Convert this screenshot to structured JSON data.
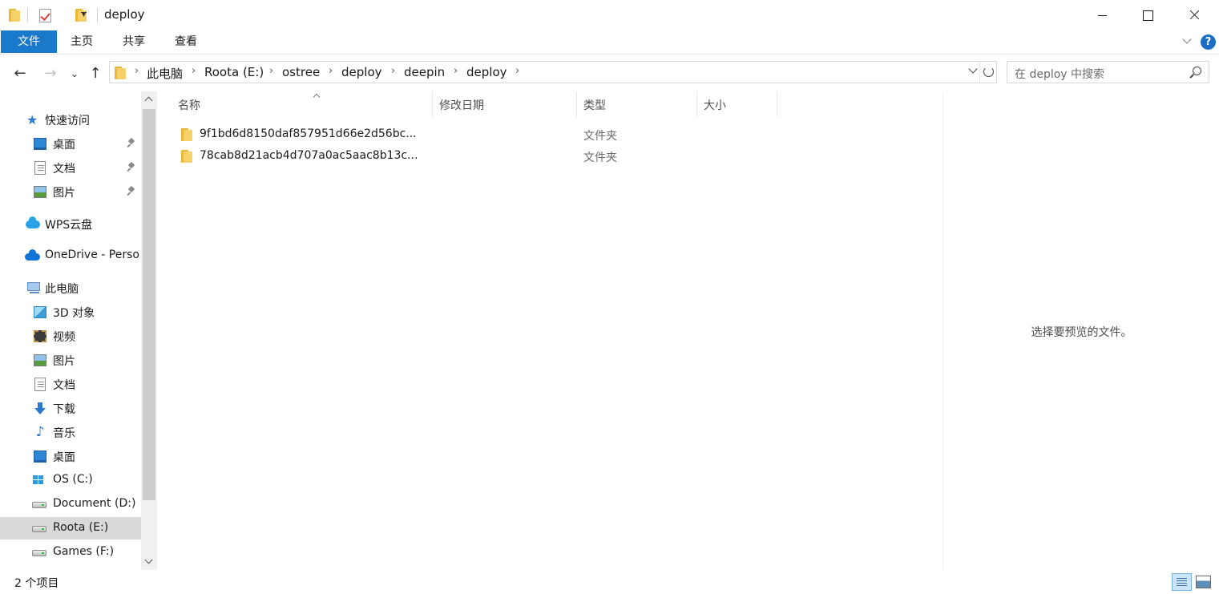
{
  "window": {
    "title": "deploy"
  },
  "quick_access_toolbar": {
    "icons": [
      "folder-icon",
      "properties-icon",
      "new-folder-icon",
      "customize-dropdown-icon"
    ]
  },
  "ribbon": {
    "tabs": [
      {
        "label": "文件",
        "active": true
      },
      {
        "label": "主页"
      },
      {
        "label": "共享"
      },
      {
        "label": "查看"
      }
    ],
    "help_label": "?"
  },
  "navigation": {
    "back": "←",
    "forward": "→",
    "recent": "⌄",
    "up": "↑"
  },
  "address": {
    "breadcrumbs": [
      "此电脑",
      "Roota (E:)",
      "ostree",
      "deploy",
      "deepin",
      "deploy"
    ],
    "separator": "›"
  },
  "search": {
    "placeholder": "在 deploy 中搜索"
  },
  "sidebar": {
    "quick_access": {
      "label": "快速访问",
      "items": [
        {
          "label": "桌面",
          "icon": "desktop-icon",
          "pinned": true
        },
        {
          "label": "文档",
          "icon": "document-icon",
          "pinned": true
        },
        {
          "label": "图片",
          "icon": "pictures-icon",
          "pinned": true
        }
      ]
    },
    "wps": {
      "label": "WPS云盘",
      "icon": "cloud-icon"
    },
    "onedrive": {
      "label": "OneDrive - Perso",
      "icon": "onedrive-icon"
    },
    "this_pc": {
      "label": "此电脑",
      "items": [
        {
          "label": "3D 对象",
          "icon": "3d-objects-icon"
        },
        {
          "label": "视频",
          "icon": "video-icon"
        },
        {
          "label": "图片",
          "icon": "pictures-icon"
        },
        {
          "label": "文档",
          "icon": "document-icon"
        },
        {
          "label": "下载",
          "icon": "download-icon"
        },
        {
          "label": "音乐",
          "icon": "music-icon"
        },
        {
          "label": "桌面",
          "icon": "desktop-icon"
        },
        {
          "label": "OS (C:)",
          "icon": "os-drive-icon"
        },
        {
          "label": "Document (D:)",
          "icon": "drive-icon"
        },
        {
          "label": "Roota (E:)",
          "icon": "drive-icon",
          "selected": true
        },
        {
          "label": "Games (F:)",
          "icon": "drive-icon"
        }
      ]
    }
  },
  "file_list": {
    "columns": [
      "名称",
      "修改日期",
      "类型",
      "大小"
    ],
    "rows": [
      {
        "name": "9f1bd6d8150daf857951d66e2d56bc...",
        "type": "文件夹",
        "icon": "folder-icon"
      },
      {
        "name": "78cab8d21acb4d707a0ac5aac8b13c...",
        "type": "文件夹",
        "icon": "folder-icon"
      }
    ]
  },
  "preview_pane": {
    "message": "选择要预览的文件。"
  },
  "status_bar": {
    "item_count": "2 个项目",
    "view_icons": [
      "details-view-icon",
      "large-icons-view-icon"
    ]
  },
  "colors": {
    "accent": "#1979ca",
    "folder": "#f6d06a",
    "selection": "#d9d9d9"
  }
}
